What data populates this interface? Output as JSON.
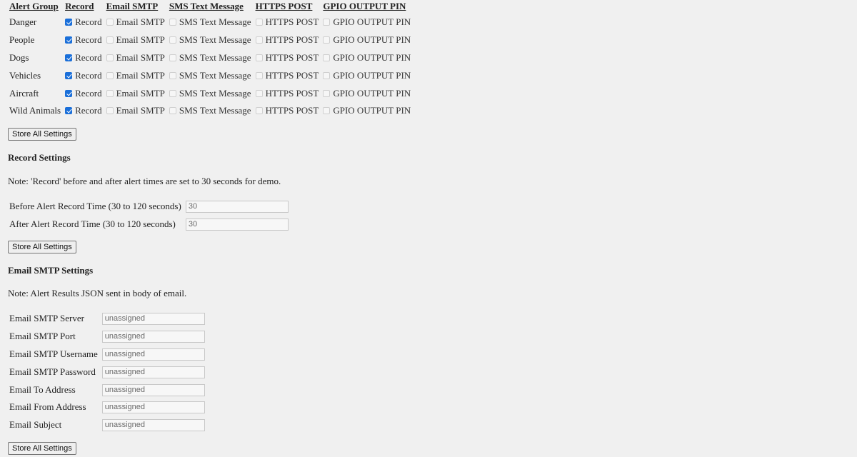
{
  "alerts": {
    "headers": [
      "Alert Group",
      "Record",
      "Email SMTP",
      "SMS Text Message",
      "HTTPS POST",
      "GPIO OUTPUT PIN"
    ],
    "rows": [
      {
        "group": "Danger",
        "checks": [
          true,
          false,
          false,
          false,
          false
        ]
      },
      {
        "group": "People",
        "checks": [
          true,
          false,
          false,
          false,
          false
        ]
      },
      {
        "group": "Dogs",
        "checks": [
          true,
          false,
          false,
          false,
          false
        ]
      },
      {
        "group": "Vehicles",
        "checks": [
          true,
          false,
          false,
          false,
          false
        ]
      },
      {
        "group": "Aircraft",
        "checks": [
          true,
          false,
          false,
          false,
          false
        ]
      },
      {
        "group": "Wild Animals",
        "checks": [
          true,
          false,
          false,
          false,
          false
        ]
      }
    ],
    "option_labels": [
      "Record",
      "Email SMTP",
      "SMS Text Message",
      "HTTPS POST",
      "GPIO OUTPUT PIN"
    ]
  },
  "store_button_label": "Store All Settings",
  "record": {
    "title": "Record Settings",
    "note": "Note: 'Record' before and after alert times are set to 30 seconds for demo.",
    "fields": [
      {
        "label": "Before Alert Record Time (30 to 120 seconds)",
        "value": "30"
      },
      {
        "label": "After Alert Record Time (30 to 120 seconds)",
        "value": "30"
      }
    ]
  },
  "email": {
    "title": "Email SMTP Settings",
    "note": "Note: Alert Results JSON sent in body of email.",
    "fields": [
      {
        "label": "Email SMTP Server",
        "value": "unassigned"
      },
      {
        "label": "Email SMTP Port",
        "value": "unassigned"
      },
      {
        "label": "Email SMTP Username",
        "value": "unassigned"
      },
      {
        "label": "Email SMTP Password",
        "value": "unassigned"
      },
      {
        "label": "Email To Address",
        "value": "unassigned"
      },
      {
        "label": "Email From Address",
        "value": "unassigned"
      },
      {
        "label": "Email Subject",
        "value": "unassigned"
      }
    ]
  }
}
